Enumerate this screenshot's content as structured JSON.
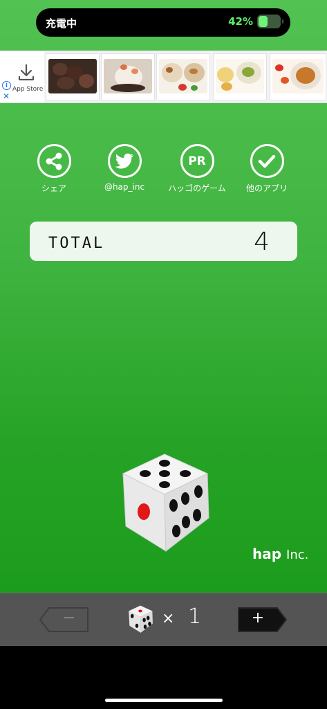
{
  "status": {
    "charging_label": "充電中",
    "battery_percent_text": "42%",
    "battery_level": 0.42
  },
  "ad": {
    "store_label": "App Store",
    "info_icon": "info-icon",
    "close_icon": "close-icon",
    "thumbnails": [
      "grilled-meat-photo",
      "seafood-dish-photo",
      "bento-box-photo",
      "salad-bowls-photo",
      "curry-plate-photo"
    ]
  },
  "nav": [
    {
      "label": "シェア",
      "icon": "share-icon"
    },
    {
      "label": "@hap_inc",
      "icon": "twitter-icon"
    },
    {
      "label": "ハッゴのゲーム",
      "icon": "pr-icon"
    },
    {
      "label": "他のアプリ",
      "icon": "checkmark-icon"
    }
  ],
  "total": {
    "label": "TOTAL",
    "value": "4"
  },
  "dice": {
    "top_face": 5,
    "front_face": 1,
    "right_face": 6
  },
  "brand": {
    "name": "hap",
    "suffix": "Inc."
  },
  "controls": {
    "minus_label": "−",
    "plus_label": "+",
    "times_label": "×",
    "dice_count": "1"
  },
  "colors": {
    "background_green": "#3fb33f",
    "controller_bg": "#545454",
    "accent_battery": "#5cf06a"
  }
}
